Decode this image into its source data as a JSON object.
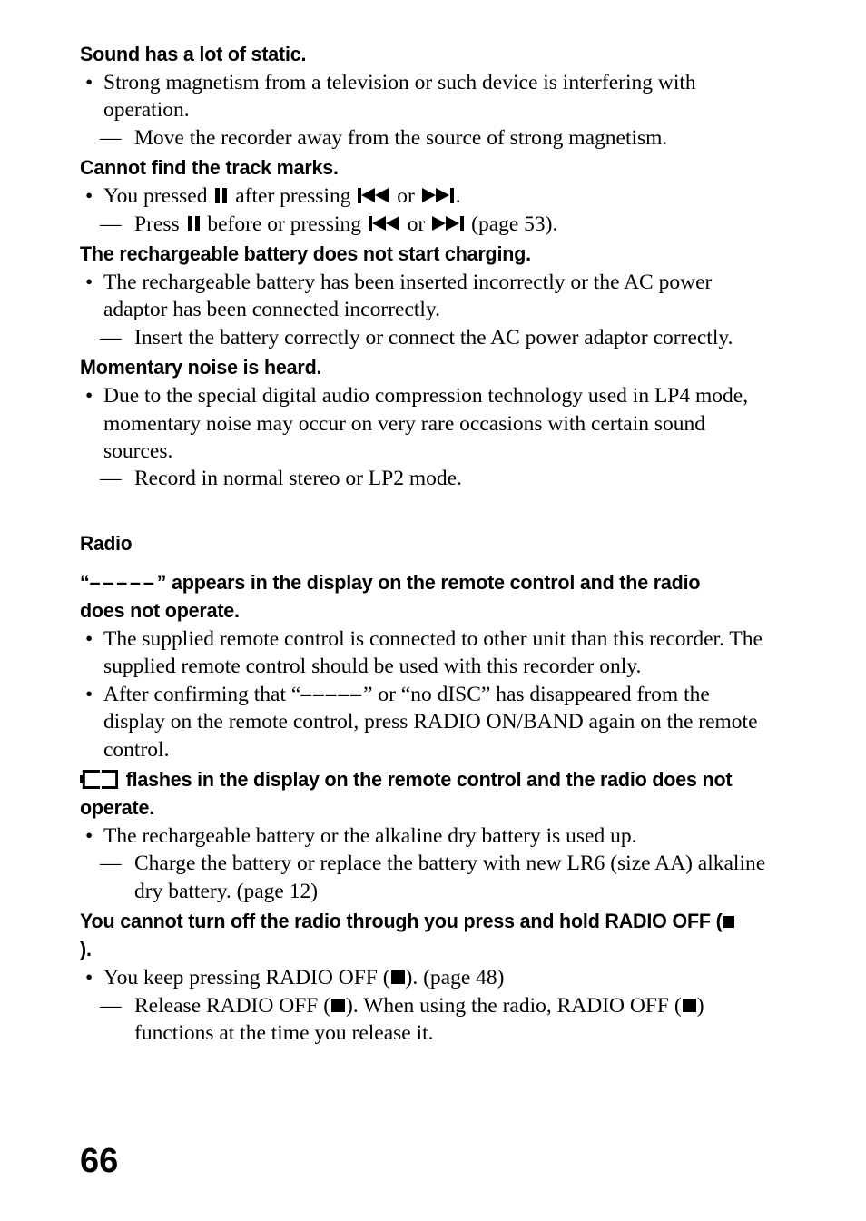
{
  "page": {
    "number": "66"
  },
  "sections": [
    {
      "heading": "Sound has a lot of static.",
      "bullet1_text": "Strong magnetism from a television or such device is interfering with operation.",
      "dash1_text": "Move the recorder away from the source of strong magnetism."
    },
    {
      "heading": "Cannot find the track marks.",
      "bullet1_pre": "You pressed",
      "bullet1_mid": "after pressing",
      "bullet1_or": "or",
      "bullet1_end": ".",
      "dash1_pre": "Press",
      "dash1_mid": "before or pressing",
      "dash1_or": "or",
      "dash1_end": "(page 53)."
    },
    {
      "heading": "The rechargeable battery does not start charging.",
      "bullet1_text": "The rechargeable battery has been inserted incorrectly or the AC power adaptor has been connected incorrectly.",
      "dash1_text": "Insert the battery correctly or connect the AC power adaptor correctly."
    },
    {
      "heading": "Momentary noise is heard.",
      "bullet1_text": "Due to the special digital audio compression technology used in LP4 mode, momentary noise may occur on very rare occasions with certain sound sources.",
      "dash1_text": "Record in normal stereo or LP2 mode."
    }
  ],
  "radio": {
    "section_heading": "Radio",
    "heading1_open_quote": "“",
    "heading1_dashes": "–––––",
    "heading1_close_quote": "”",
    "heading1_rest": "appears in the display on the remote control and the radio does not operate.",
    "bullet1_text": "The supplied remote control is connected to other unit than this recorder. The supplied remote control should be used with this recorder only.",
    "bullet2_pre": "After confirming that “",
    "bullet2_dashes": "–––––",
    "bullet2_post": "” or “no dISC” has disappeared from the display on the remote control, press RADIO ON/BAND again on the remote control.",
    "heading2_rest": "flashes in the display on the remote control and the radio does not operate.",
    "heading2_icon": "empty-battery-icon",
    "bullet3_text": "The rechargeable battery or the alkaline dry battery is used up.",
    "dash3_text": "Charge the battery or replace the battery with new LR6 (size AA) alkaline dry battery. (page 12)",
    "heading3_pre": "You cannot turn off the radio through you press and hold RADIO OFF (",
    "heading3_post": ").",
    "bullet4_pre": "You keep pressing RADIO OFF (",
    "bullet4_post": "). (page 48)",
    "dash4_pre": "Release RADIO OFF (",
    "dash4_mid": "). When using the radio, RADIO OFF (",
    "dash4_post": ") functions at the time you release it."
  },
  "glyphs": {
    "pause": "pause-icon",
    "previous": "previous-track-icon",
    "next": "next-track-icon",
    "stop": "stop-icon"
  },
  "colors": {
    "text": "#000000",
    "background": "#ffffff"
  }
}
